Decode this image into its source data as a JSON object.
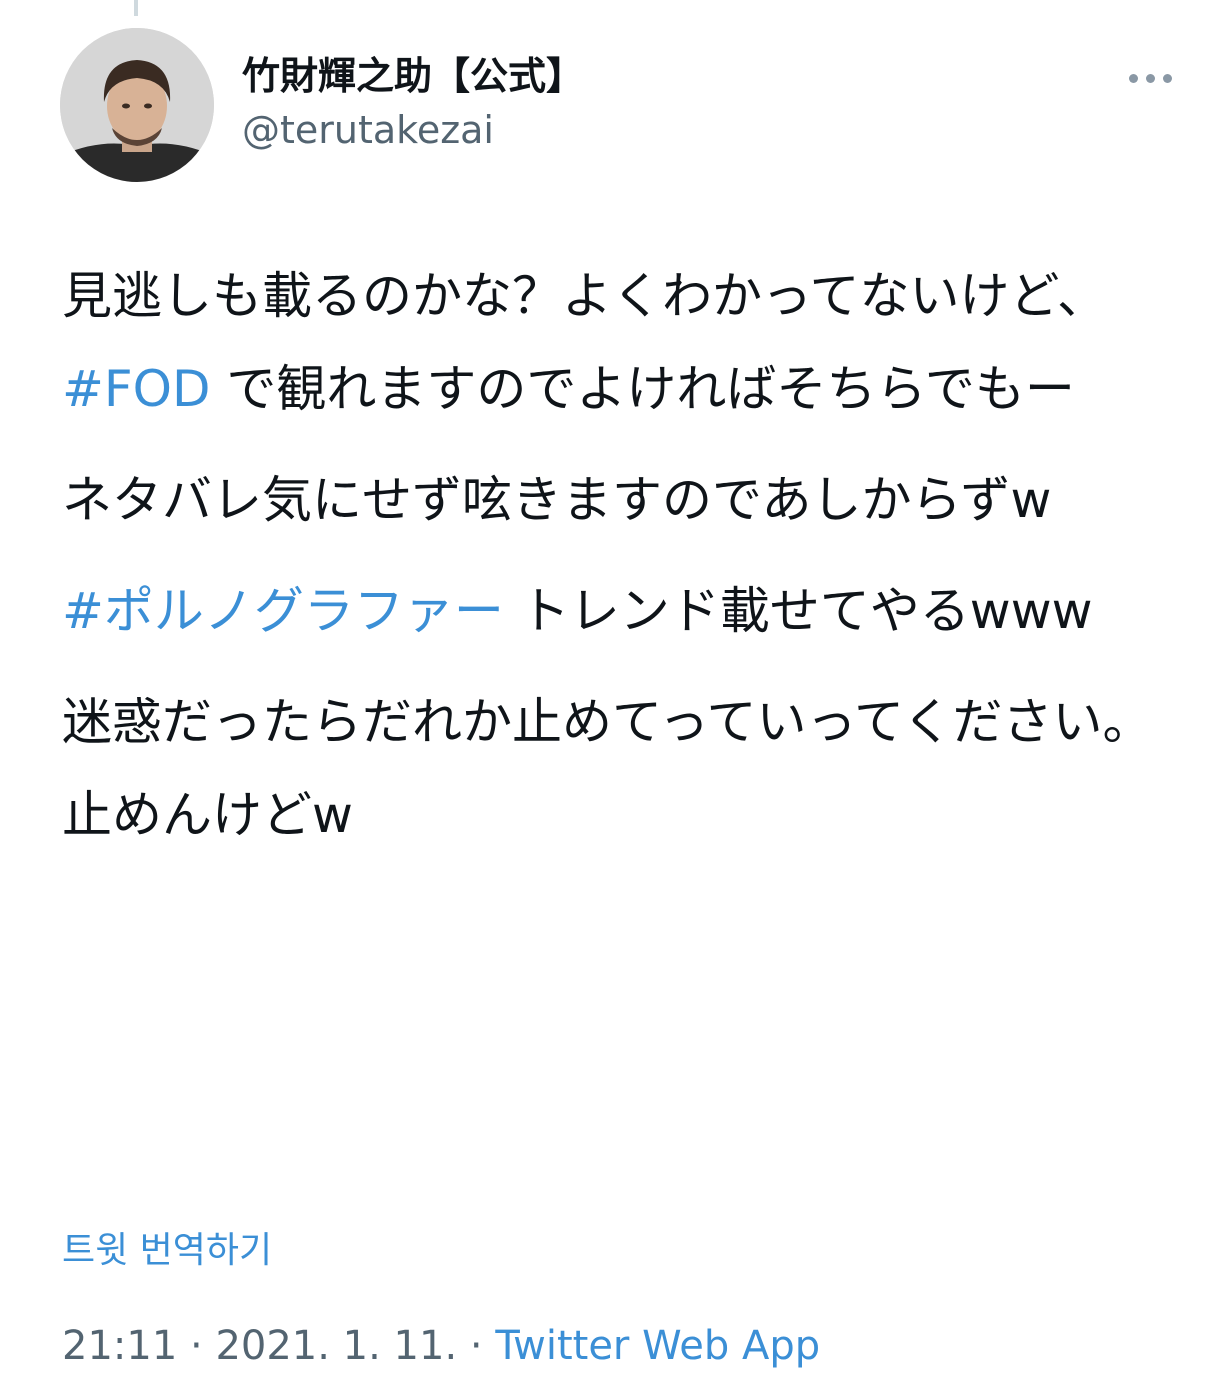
{
  "author": {
    "display_name": "竹財輝之助【公式】",
    "handle": "@terutakezai",
    "avatar_icon": "profile-photo"
  },
  "menu": {
    "more_icon": "more-horizontal-icon"
  },
  "tweet": {
    "paragraphs": [
      [
        {
          "text": "見逃しも載るのかな？よくわかってないけど、"
        },
        {
          "text": "#FOD",
          "hashtag": true
        },
        {
          "text": " で観れますのでよければそちらでもー"
        }
      ],
      [
        {
          "text": "ネタバレ気にせず呟きますのであしからずw"
        }
      ],
      [
        {
          "text": "#ポルノグラファー",
          "hashtag": true
        },
        {
          "text": " トレンド載せてやるwww"
        }
      ],
      [
        {
          "text": "迷惑だったらだれか止めてっていってください。止めんけどw"
        }
      ]
    ]
  },
  "translate_label": "트윗 번역하기",
  "meta": {
    "time": "21:11",
    "separator": " · ",
    "date": "2021. 1. 11.",
    "source": "Twitter Web App"
  },
  "colors": {
    "link": "#3b8fd6",
    "text": "#0f1419",
    "secondary": "#536471"
  }
}
